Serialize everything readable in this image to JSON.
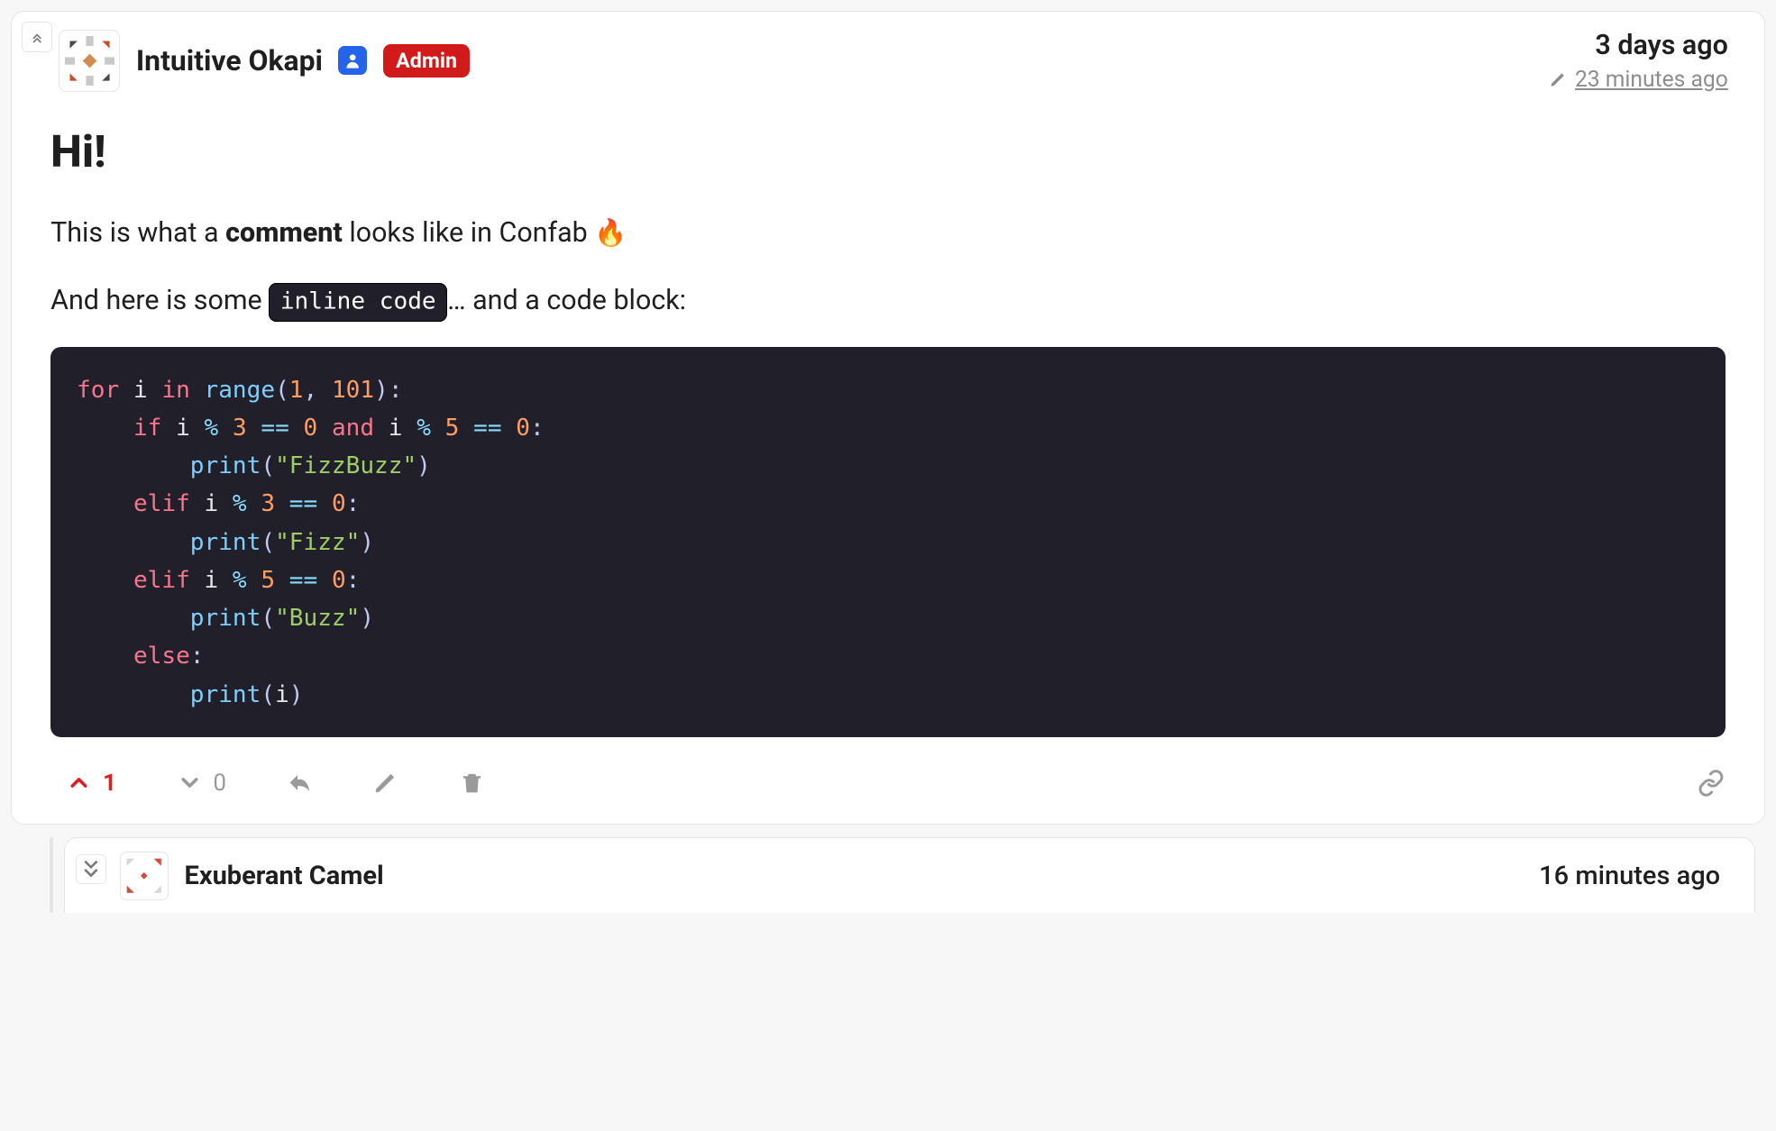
{
  "comments": [
    {
      "author": "Intuitive Okapi",
      "role_badge": "Admin",
      "posted": "3 days ago",
      "edited": "23 minutes ago",
      "body": {
        "heading": "Hi!",
        "p1_prefix": "This is what a ",
        "p1_bold": "comment",
        "p1_suffix": " looks like in Confab ",
        "p1_emoji": "🔥",
        "p2_prefix": "And here is some ",
        "inline_code": "inline code",
        "p2_mid": "… and a code block:"
      },
      "code_block": [
        {
          "seg": [
            [
              "kw",
              "for"
            ],
            [
              "",
              " i "
            ],
            [
              "kw",
              "in"
            ],
            [
              "",
              " "
            ],
            [
              "fn",
              "range"
            ],
            [
              "p",
              "("
            ],
            [
              "num",
              "1"
            ],
            [
              "p",
              ","
            ],
            [
              "",
              " "
            ],
            [
              "num",
              "101"
            ],
            [
              "p",
              ")"
            ],
            [
              "p",
              ":"
            ]
          ]
        },
        {
          "seg": [
            [
              "",
              "    "
            ],
            [
              "kw",
              "if"
            ],
            [
              "",
              " i "
            ],
            [
              "op",
              "%"
            ],
            [
              "",
              " "
            ],
            [
              "num",
              "3"
            ],
            [
              "",
              " "
            ],
            [
              "op",
              "=="
            ],
            [
              "",
              " "
            ],
            [
              "num",
              "0"
            ],
            [
              "",
              " "
            ],
            [
              "kw",
              "and"
            ],
            [
              "",
              " i "
            ],
            [
              "op",
              "%"
            ],
            [
              "",
              " "
            ],
            [
              "num",
              "5"
            ],
            [
              "",
              " "
            ],
            [
              "op",
              "=="
            ],
            [
              "",
              " "
            ],
            [
              "num",
              "0"
            ],
            [
              "p",
              ":"
            ]
          ]
        },
        {
          "seg": [
            [
              "",
              "        "
            ],
            [
              "fn",
              "print"
            ],
            [
              "p",
              "("
            ],
            [
              "str",
              "\"FizzBuzz\""
            ],
            [
              "p",
              ")"
            ]
          ]
        },
        {
          "seg": [
            [
              "",
              "    "
            ],
            [
              "kw",
              "elif"
            ],
            [
              "",
              " i "
            ],
            [
              "op",
              "%"
            ],
            [
              "",
              " "
            ],
            [
              "num",
              "3"
            ],
            [
              "",
              " "
            ],
            [
              "op",
              "=="
            ],
            [
              "",
              " "
            ],
            [
              "num",
              "0"
            ],
            [
              "p",
              ":"
            ]
          ]
        },
        {
          "seg": [
            [
              "",
              "        "
            ],
            [
              "fn",
              "print"
            ],
            [
              "p",
              "("
            ],
            [
              "str",
              "\"Fizz\""
            ],
            [
              "p",
              ")"
            ]
          ]
        },
        {
          "seg": [
            [
              "",
              "    "
            ],
            [
              "kw",
              "elif"
            ],
            [
              "",
              " i "
            ],
            [
              "op",
              "%"
            ],
            [
              "",
              " "
            ],
            [
              "num",
              "5"
            ],
            [
              "",
              " "
            ],
            [
              "op",
              "=="
            ],
            [
              "",
              " "
            ],
            [
              "num",
              "0"
            ],
            [
              "p",
              ":"
            ]
          ]
        },
        {
          "seg": [
            [
              "",
              "        "
            ],
            [
              "fn",
              "print"
            ],
            [
              "p",
              "("
            ],
            [
              "str",
              "\"Buzz\""
            ],
            [
              "p",
              ")"
            ]
          ]
        },
        {
          "seg": [
            [
              "",
              "    "
            ],
            [
              "kw",
              "else"
            ],
            [
              "p",
              ":"
            ]
          ]
        },
        {
          "seg": [
            [
              "",
              "        "
            ],
            [
              "fn",
              "print"
            ],
            [
              "p",
              "("
            ],
            [
              "",
              "i"
            ],
            [
              "p",
              ")"
            ]
          ]
        }
      ],
      "upvotes": "1",
      "downvotes": "0"
    },
    {
      "author": "Exuberant Camel",
      "posted": "16 minutes ago"
    }
  ]
}
